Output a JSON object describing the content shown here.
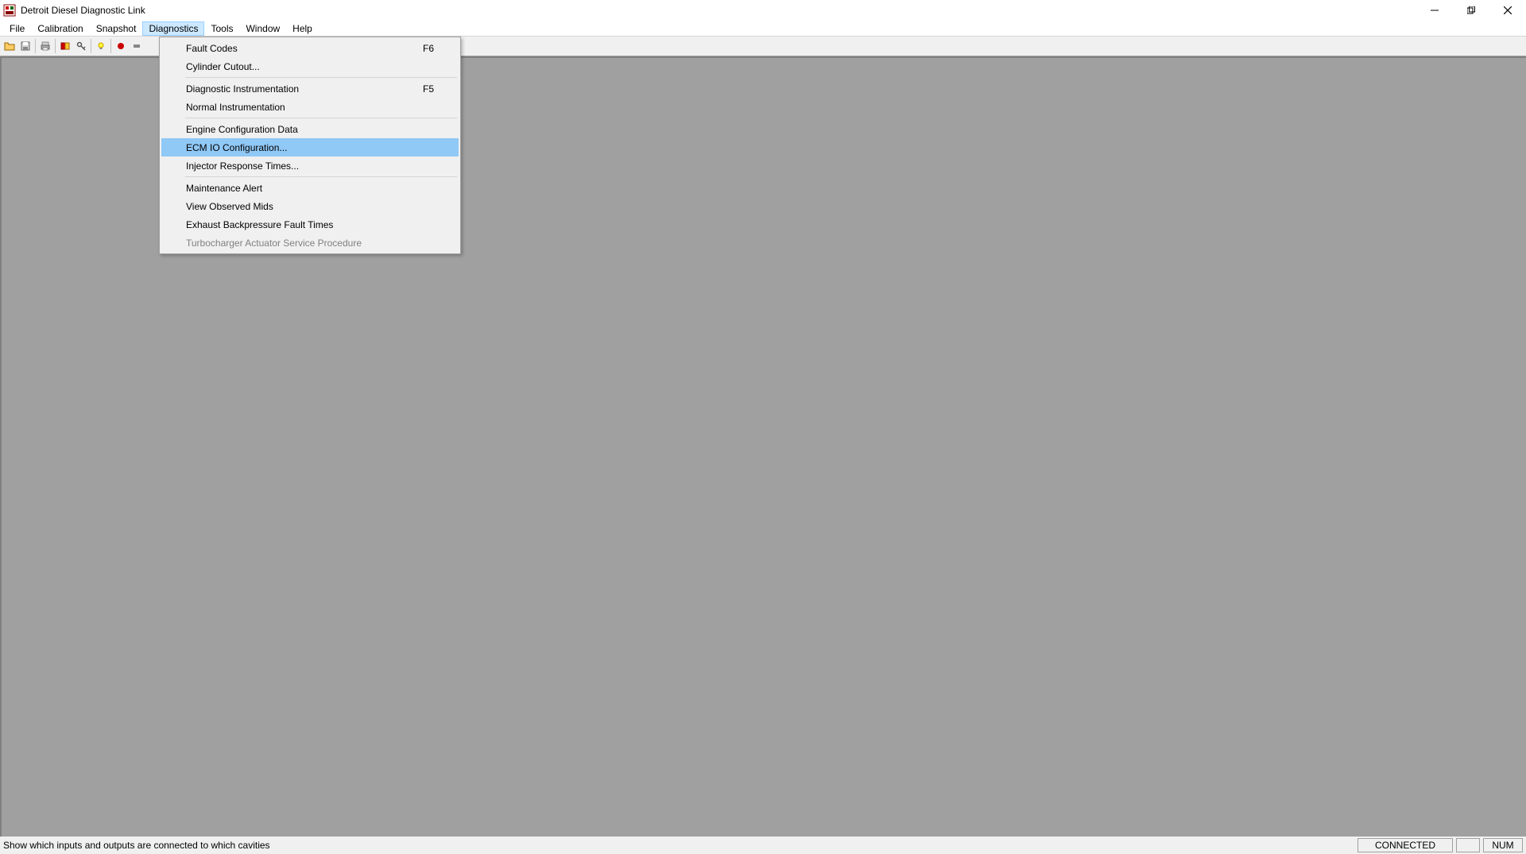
{
  "app": {
    "title": "Detroit Diesel Diagnostic Link"
  },
  "menubar": {
    "items": [
      {
        "label": "File"
      },
      {
        "label": "Calibration"
      },
      {
        "label": "Snapshot"
      },
      {
        "label": "Diagnostics"
      },
      {
        "label": "Tools"
      },
      {
        "label": "Window"
      },
      {
        "label": "Help"
      }
    ]
  },
  "dropdown": {
    "items": [
      {
        "label": "Fault Codes",
        "shortcut": "F6"
      },
      {
        "label": "Cylinder Cutout..."
      },
      {
        "label": "Diagnostic Instrumentation",
        "shortcut": "F5"
      },
      {
        "label": "Normal Instrumentation"
      },
      {
        "label": "Engine Configuration Data"
      },
      {
        "label": "ECM IO Configuration..."
      },
      {
        "label": "Injector Response Times..."
      },
      {
        "label": "Maintenance Alert"
      },
      {
        "label": "View Observed Mids"
      },
      {
        "label": "Exhaust Backpressure Fault Times"
      },
      {
        "label": "Turbocharger Actuator Service Procedure"
      }
    ]
  },
  "statusbar": {
    "hint": "Show which inputs and outputs are connected to which cavities",
    "connected": "CONNECTED",
    "num": "NUM"
  }
}
